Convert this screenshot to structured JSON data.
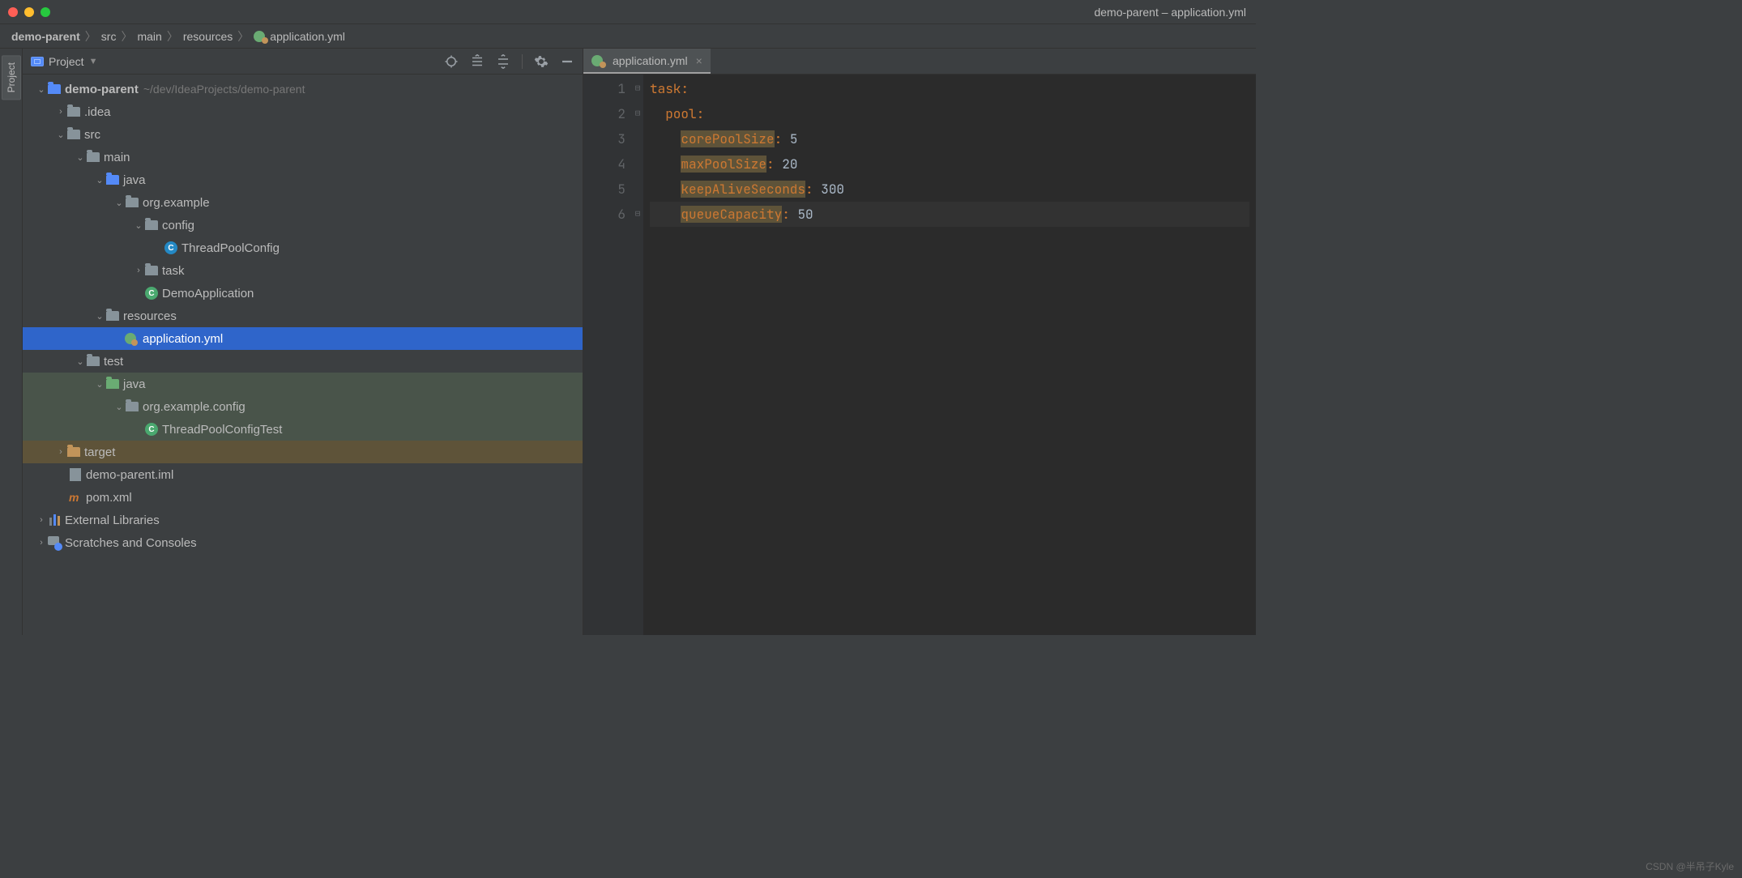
{
  "window": {
    "title": "demo-parent – application.yml"
  },
  "breadcrumbs": {
    "root": "demo-parent",
    "p1": "src",
    "p2": "main",
    "p3": "resources",
    "file": "application.yml"
  },
  "side_tab": "Project",
  "panel": {
    "title": "Project"
  },
  "tree": {
    "root": "demo-parent",
    "root_hint": "~/dev/IdeaProjects/demo-parent",
    "idea": ".idea",
    "src": "src",
    "main": "main",
    "java": "java",
    "pkg": "org.example",
    "config": "config",
    "threadpool": "ThreadPoolConfig",
    "task": "task",
    "demoapp": "DemoApplication",
    "resources": "resources",
    "appyml": "application.yml",
    "test": "test",
    "test_java": "java",
    "test_pkg": "org.example.config",
    "test_class": "ThreadPoolConfigTest",
    "target": "target",
    "iml": "demo-parent.iml",
    "pom": "pom.xml",
    "extlib": "External Libraries",
    "scratches": "Scratches and Consoles"
  },
  "editor": {
    "tab_name": "application.yml",
    "lines": [
      "1",
      "2",
      "3",
      "4",
      "5",
      "6"
    ],
    "code": {
      "l1_key": "task",
      "l2_key": "pool",
      "l3_key": "corePoolSize",
      "l3_val": "5",
      "l4_key": "maxPoolSize",
      "l4_val": "20",
      "l5_key": "keepAliveSeconds",
      "l5_val": "300",
      "l6_key": "queueCapacity",
      "l6_val": "50"
    }
  },
  "watermark": "CSDN @半吊子Kyle"
}
